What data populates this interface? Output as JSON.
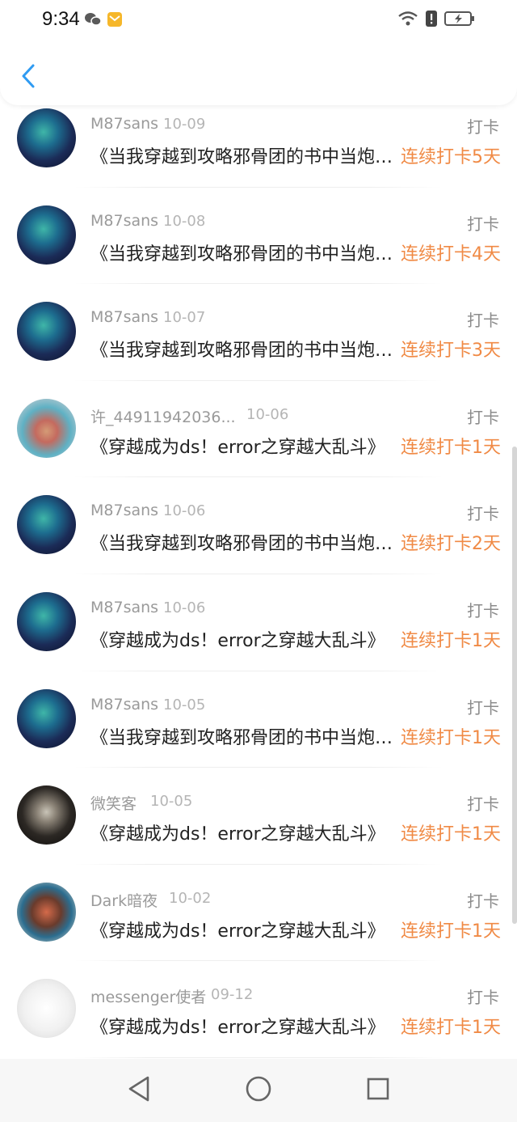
{
  "status_bar": {
    "time": "9:34",
    "icons": [
      "wechat-icon",
      "mail-notification-icon",
      "wifi-icon",
      "alert-icon",
      "battery-charging-icon"
    ]
  },
  "header": {
    "back_icon": "chevron-left-icon"
  },
  "colors": {
    "accent_blue": "#2f9bf2",
    "streak_orange": "#f08a45",
    "name_gray": "#9a9a9a",
    "date_gray": "#b5b5b5"
  },
  "records": [
    {
      "name": "M87sans",
      "date": "10-09",
      "type": "打卡",
      "title": "《当我穿越到攻略邪骨团的书中当炮灰》",
      "streak": "连续打卡5天",
      "avatar": "dark"
    },
    {
      "name": "M87sans",
      "date": "10-08",
      "type": "打卡",
      "title": "《当我穿越到攻略邪骨团的书中当炮灰》",
      "streak": "连续打卡4天",
      "avatar": "dark"
    },
    {
      "name": "M87sans",
      "date": "10-07",
      "type": "打卡",
      "title": "《当我穿越到攻略邪骨团的书中当炮灰》",
      "streak": "连续打卡3天",
      "avatar": "dark"
    },
    {
      "name": "许_44911942036...",
      "date": "10-06",
      "type": "打卡",
      "title": "《穿越成为ds！error之穿越大乱斗》",
      "streak": "连续打卡1天",
      "avatar": "photo"
    },
    {
      "name": "M87sans",
      "date": "10-06",
      "type": "打卡",
      "title": "《当我穿越到攻略邪骨团的书中当炮灰》",
      "streak": "连续打卡2天",
      "avatar": "dark"
    },
    {
      "name": "M87sans",
      "date": "10-06",
      "type": "打卡",
      "title": "《穿越成为ds！error之穿越大乱斗》",
      "streak": "连续打卡1天",
      "avatar": "dark"
    },
    {
      "name": "M87sans",
      "date": "10-05",
      "type": "打卡",
      "title": "《当我穿越到攻略邪骨团的书中当炮灰》",
      "streak": "连续打卡1天",
      "avatar": "dark"
    },
    {
      "name": "微笑客",
      "date": "10-05",
      "type": "打卡",
      "title": "《穿越成为ds！error之穿越大乱斗》",
      "streak": "连续打卡1天",
      "avatar": "ghost"
    },
    {
      "name": "Dark暗夜",
      "date": "10-02",
      "type": "打卡",
      "title": "《穿越成为ds！error之穿越大乱斗》",
      "streak": "连续打卡1天",
      "avatar": "comic"
    },
    {
      "name": "messenger使者",
      "date": "09-12",
      "type": "打卡",
      "title": "《穿越成为ds！error之穿越大乱斗》",
      "streak": "连续打卡1天",
      "avatar": "sketch"
    }
  ],
  "nav_bar": {
    "buttons": [
      "back-triangle-icon",
      "home-circle-icon",
      "recents-square-icon"
    ]
  }
}
